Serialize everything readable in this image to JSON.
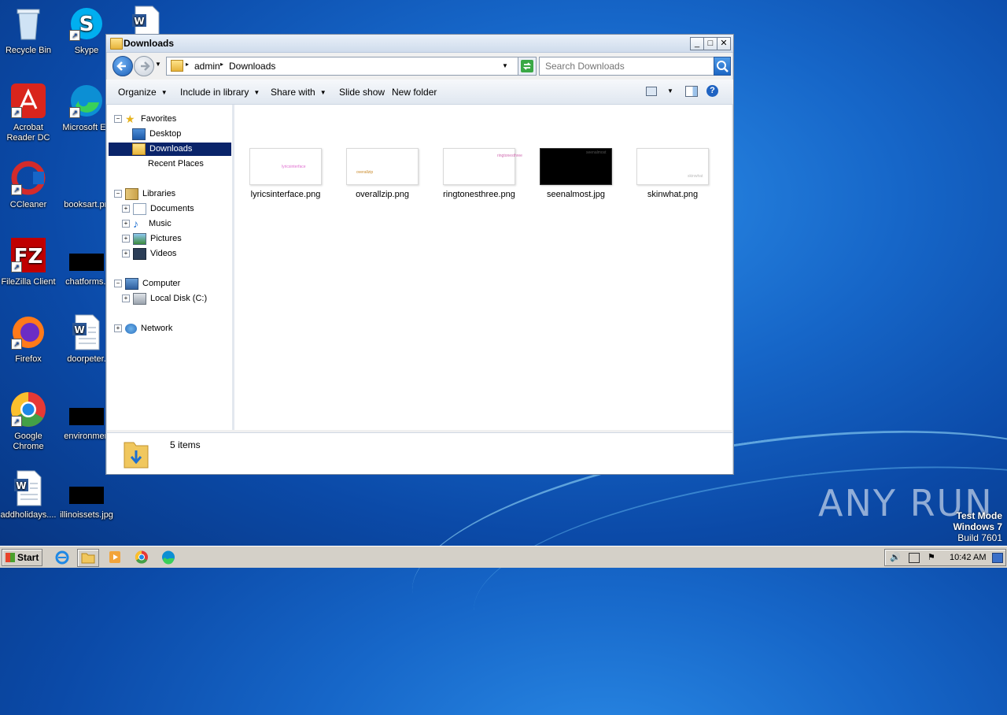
{
  "desktop": {
    "icons": [
      {
        "label": "Recycle Bin"
      },
      {
        "label": "Skype"
      },
      {
        "label": "Acrobat Reader DC"
      },
      {
        "label": "Microsoft Ed"
      },
      {
        "label": "CCleaner"
      },
      {
        "label": "booksart.pn"
      },
      {
        "label": "FileZilla Client"
      },
      {
        "label": "chatforms.j"
      },
      {
        "label": "Firefox"
      },
      {
        "label": "doorpeter."
      },
      {
        "label": "Google Chrome"
      },
      {
        "label": "environmen"
      },
      {
        "label": "addholidays...."
      },
      {
        "label": "illinoissets.jpg"
      }
    ]
  },
  "window": {
    "title": "Downloads",
    "controls": {
      "minimize": "_",
      "maximize": "□",
      "close": "✕"
    },
    "address": {
      "crumbs": [
        "admin",
        "Downloads"
      ]
    },
    "search": {
      "placeholder": "Search Downloads"
    },
    "toolbar": {
      "organize": "Organize",
      "include": "Include in library",
      "share": "Share with",
      "slideshow": "Slide show",
      "newfolder": "New folder"
    },
    "nav": {
      "favorites": "Favorites",
      "desktop": "Desktop",
      "downloads": "Downloads",
      "recent": "Recent Places",
      "libraries": "Libraries",
      "documents": "Documents",
      "music": "Music",
      "pictures": "Pictures",
      "videos": "Videos",
      "computer": "Computer",
      "localdisk": "Local Disk (C:)",
      "network": "Network"
    },
    "files": [
      {
        "name": "lyricsinterface.png",
        "thumb_text": "lyricsinterface",
        "thumb_color": "#e06fd0",
        "dark": false
      },
      {
        "name": "overallzip.png",
        "thumb_text": "overallzip",
        "thumb_color": "#c98a2a",
        "dark": false
      },
      {
        "name": "ringtonesthree.png",
        "thumb_text": "ringtonesthree",
        "thumb_color": "#d06ab0",
        "dark": false
      },
      {
        "name": "seenalmost.jpg",
        "thumb_text": "seenalmost",
        "thumb_color": "#555555",
        "dark": true
      },
      {
        "name": "skinwhat.png",
        "thumb_text": "skinwhat",
        "thumb_color": "#bbbbbb",
        "dark": false
      }
    ],
    "details": {
      "count": "5 items"
    }
  },
  "taskbar": {
    "start": "Start",
    "clock": "10:42 AM"
  },
  "watermark": {
    "text": "ANY RUN"
  },
  "testmode": {
    "line1": "Test Mode",
    "line2": "Windows 7",
    "line3": "Build 7601"
  }
}
